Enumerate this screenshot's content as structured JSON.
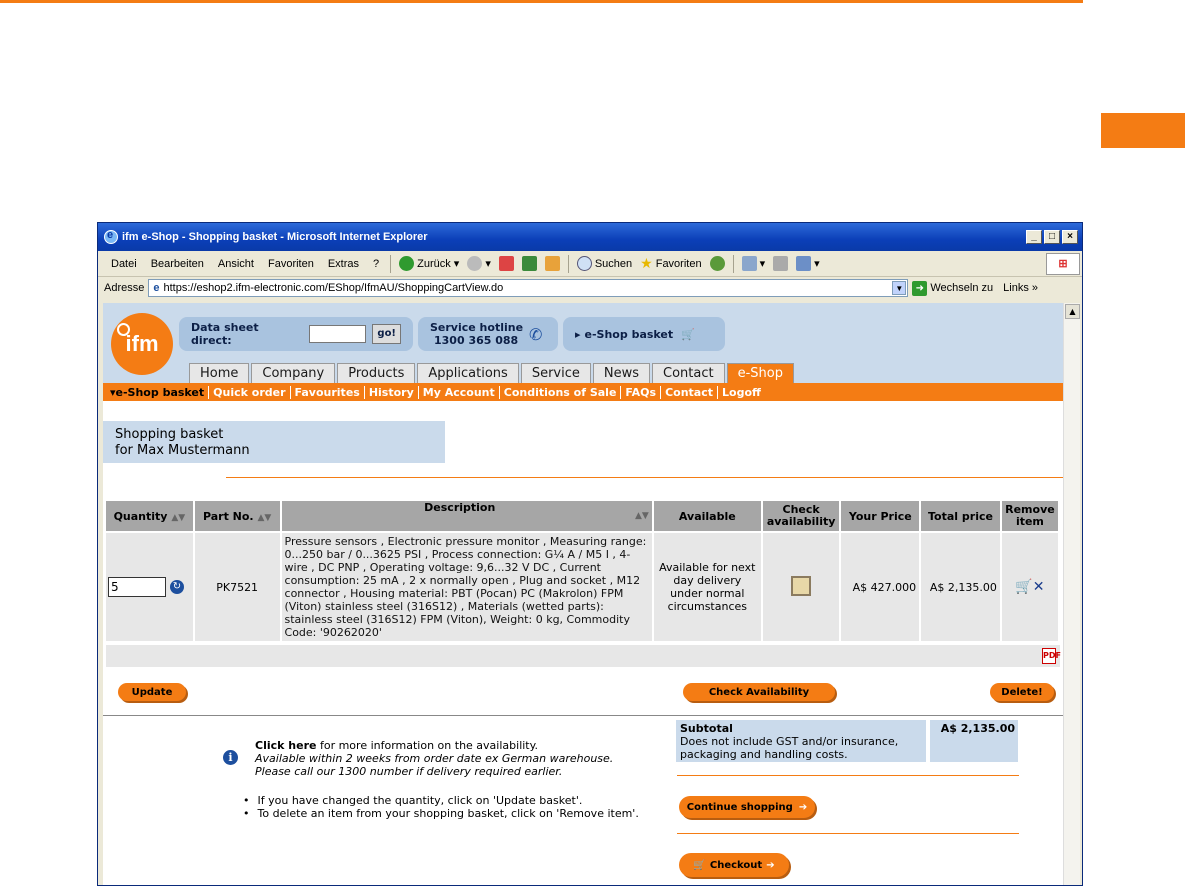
{
  "window": {
    "title": "ifm e-Shop - Shopping basket - Microsoft Internet Explorer",
    "minimize": "_",
    "maximize": "□",
    "close": "×"
  },
  "menu": [
    "Datei",
    "Bearbeiten",
    "Ansicht",
    "Favoriten",
    "Extras",
    "?"
  ],
  "toolbar": {
    "back": "Zurück",
    "search": "Suchen",
    "favorites": "Favoriten"
  },
  "address": {
    "label": "Adresse",
    "url": "https://eshop2.ifm-electronic.com/EShop/IfmAU/ShoppingCartView.do",
    "go": "Wechseln zu",
    "links": "Links"
  },
  "header": {
    "logo": "ifm",
    "datasheet_label": "Data sheet direct:",
    "datasheet_go": "go!",
    "hotline_label": "Service hotline",
    "hotline_number": "1300 365 088",
    "basket_link": "e-Shop basket"
  },
  "nav": [
    "Home",
    "Company",
    "Products",
    "Applications",
    "Service",
    "News",
    "Contact",
    "e-Shop"
  ],
  "subnav": [
    "e-Shop basket",
    "Quick order",
    "Favourites",
    "History",
    "My Account",
    "Conditions of Sale",
    "FAQs",
    "Contact",
    "Logoff"
  ],
  "basket": {
    "title_line1": "Shopping basket",
    "title_line2": "for Max Mustermann"
  },
  "table": {
    "headers": {
      "quantity": "Quantity",
      "part_no": "Part No.",
      "description": "Description",
      "available": "Available",
      "check_availability": "Check availability",
      "your_price": "Your Price",
      "total_price": "Total price",
      "remove_item": "Remove item"
    },
    "rows": [
      {
        "quantity": "5",
        "part_no": "PK7521",
        "description": "Pressure sensors , Electronic pressure monitor , Measuring range: 0...250 bar / 0...3625 PSI , Process connection: G¼ A / M5 I , 4-wire , DC PNP , Operating voltage: 9,6...32 V DC , Current consumption: 25 mA , 2 x normally open , Plug and socket , M12 connector , Housing material: PBT (Pocan) PC (Makrolon) FPM (Viton) stainless steel (316S12) , Materials (wetted parts): stainless steel (316S12) FPM (Viton), Weight: 0 kg, Commodity Code: '90262020'",
        "available": "Available for next day delivery under normal circumstances",
        "your_price": "A$ 427.000",
        "total_price": "A$ 2,135.00"
      }
    ]
  },
  "buttons": {
    "update": "Update",
    "check_availability": "Check Availability",
    "delete": "Delete!",
    "continue_shopping": "Continue shopping",
    "checkout": "Checkout"
  },
  "info": {
    "click_here": "Click here",
    "click_rest": " for more information on the availability.",
    "line2": "Available within 2 weeks from order date ex German warehouse.",
    "line3": "Please call our 1300 number if delivery required earlier.",
    "bullet1": "If you have changed the quantity, click on 'Update basket'.",
    "bullet2": "To delete an item from your shopping basket, click on 'Remove item'."
  },
  "subtotal": {
    "label": "Subtotal",
    "note": "Does not include GST and/or insurance, packaging and handling costs.",
    "value": "A$ 2,135.00"
  },
  "colors": {
    "accent": "#f47c14",
    "header_blue": "#cadaeb",
    "table_header": "#a6a6a6"
  }
}
